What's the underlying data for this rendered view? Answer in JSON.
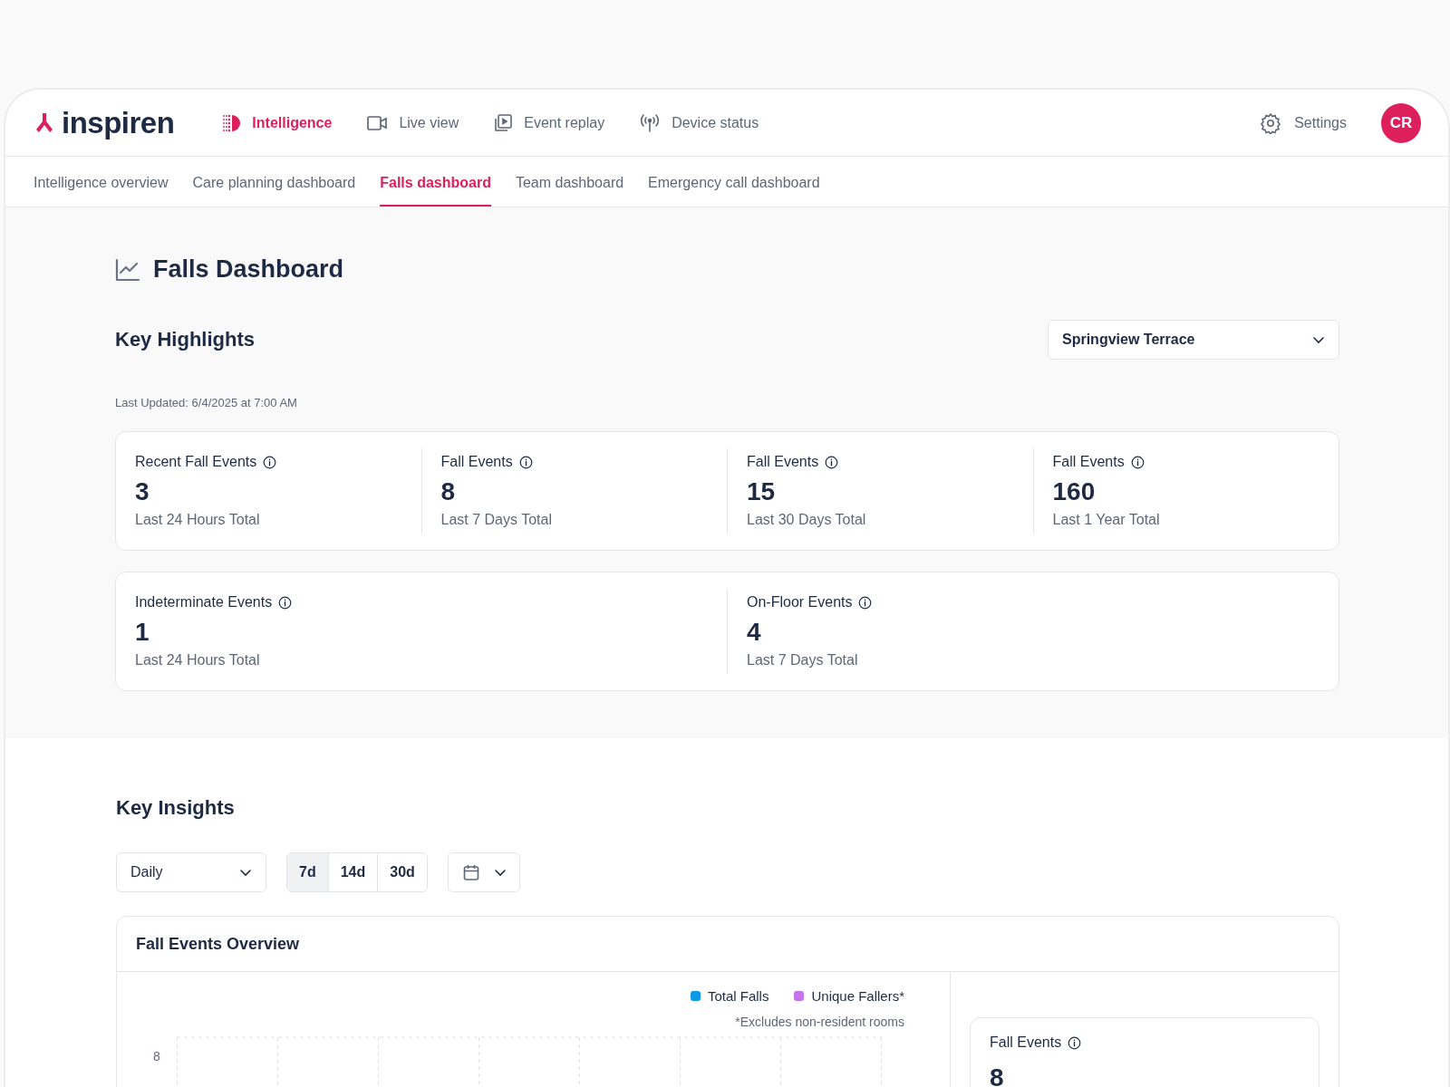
{
  "header": {
    "logo": "inspiren",
    "nav_items": [
      {
        "label": "Intelligence",
        "selected": true
      },
      {
        "label": "Live view",
        "selected": false
      },
      {
        "label": "Event replay",
        "selected": false
      },
      {
        "label": "Device status",
        "selected": false
      }
    ],
    "settings": "Settings",
    "avatar": "CR"
  },
  "subtabs": [
    {
      "label": "Intelligence overview",
      "selected": false
    },
    {
      "label": "Care planning dashboard",
      "selected": false
    },
    {
      "label": "Falls dashboard",
      "selected": true
    },
    {
      "label": "Team dashboard",
      "selected": false
    },
    {
      "label": "Emergency call dashboard",
      "selected": false
    }
  ],
  "page_title": "Falls Dashboard",
  "highlights": {
    "title": "Key Highlights",
    "facility": "Springview Terrace",
    "last_updated": "Last Updated: 6/4/2025 at 7:00 AM",
    "cards": [
      {
        "stats": [
          {
            "label": "Recent Fall Events",
            "value": "3",
            "caption": "Last 24 Hours Total"
          },
          {
            "label": "Fall Events",
            "value": "8",
            "caption": "Last 7 Days Total"
          },
          {
            "label": "Fall Events",
            "value": "15",
            "caption": "Last 30 Days Total"
          },
          {
            "label": "Fall Events",
            "value": "160",
            "caption": "Last 1 Year Total"
          }
        ]
      },
      {
        "stats": [
          {
            "label": "Indeterminate Events",
            "value": "1",
            "caption": "Last 24 Hours Total"
          },
          {
            "label": "On-Floor Events",
            "value": "4",
            "caption": "Last 7 Days Total"
          }
        ]
      }
    ]
  },
  "insights": {
    "title": "Key Insights",
    "interval": "Daily",
    "ranges": [
      {
        "label": "7d",
        "selected": true
      },
      {
        "label": "14d",
        "selected": false
      },
      {
        "label": "30d",
        "selected": false
      }
    ],
    "chart_card": {
      "title": "Fall Events Overview",
      "legend": [
        {
          "label": "Total Falls",
          "color": "#0b99e8"
        },
        {
          "label": "Unique Fallers*",
          "color": "#c873ee"
        }
      ],
      "footnote": "*Excludes non-resident rooms",
      "y_tick": "8",
      "side_metric": {
        "label": "Fall Events",
        "value": "8"
      }
    }
  }
}
